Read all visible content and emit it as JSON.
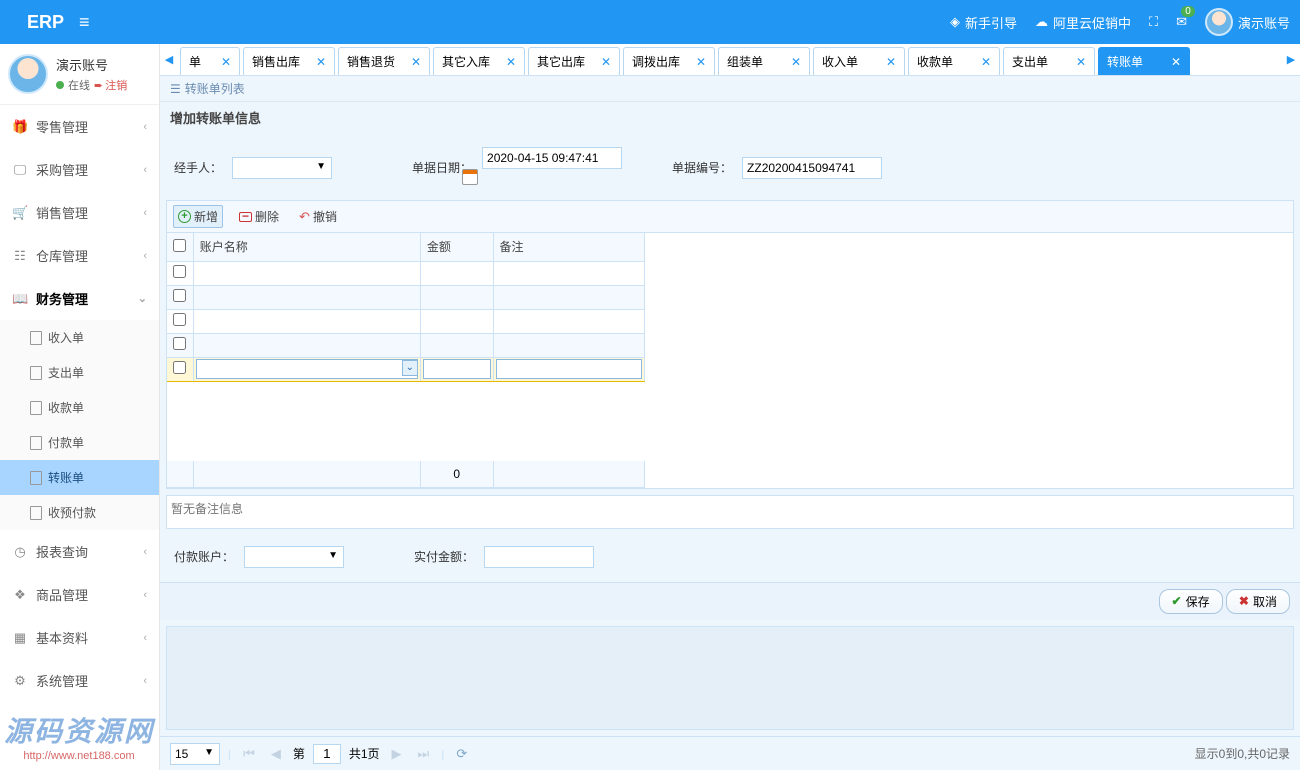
{
  "header": {
    "brand": "ERP",
    "guide": "新手引导",
    "promo": "阿里云促销中",
    "msg_badge": "0",
    "username": "演示账号"
  },
  "user_block": {
    "name": "演示账号",
    "online": "在线",
    "logout": "注销"
  },
  "sidebar": {
    "items": [
      {
        "label": "零售管理"
      },
      {
        "label": "采购管理"
      },
      {
        "label": "销售管理"
      },
      {
        "label": "仓库管理"
      },
      {
        "label": "财务管理"
      },
      {
        "label": "报表查询"
      },
      {
        "label": "商品管理"
      },
      {
        "label": "基本资料"
      },
      {
        "label": "系统管理"
      }
    ],
    "finance_sub": [
      {
        "label": "收入单"
      },
      {
        "label": "支出单"
      },
      {
        "label": "收款单"
      },
      {
        "label": "付款单"
      },
      {
        "label": "转账单"
      },
      {
        "label": "收预付款"
      }
    ]
  },
  "tabs": [
    {
      "label": "单"
    },
    {
      "label": "销售出库"
    },
    {
      "label": "销售退货"
    },
    {
      "label": "其它入库"
    },
    {
      "label": "其它出库"
    },
    {
      "label": "调拨出库"
    },
    {
      "label": "组装单"
    },
    {
      "label": "收入单"
    },
    {
      "label": "收款单"
    },
    {
      "label": "支出单"
    },
    {
      "label": "转账单"
    }
  ],
  "crumbs": "转账单列表",
  "section_title": "增加转账单信息",
  "form": {
    "handler_label": "经手人：",
    "date_label": "单据日期：",
    "date_value": "2020-04-15 09:47:41",
    "code_label": "单据编号：",
    "code_value": "ZZ20200415094741",
    "pay_account_label": "付款账户：",
    "actual_pay_label": "实付金额："
  },
  "toolbar": {
    "add": "新增",
    "delete": "删除",
    "undo": "撤销"
  },
  "grid": {
    "cols": [
      "账户名称",
      "金额",
      "备注"
    ],
    "footer_amount": "0"
  },
  "remarks_placeholder": "暂无备注信息",
  "actions": {
    "save": "保存",
    "cancel": "取消"
  },
  "pager": {
    "page_size": "15",
    "page_label_prefix": "第",
    "page_value": "1",
    "page_total": "共1页",
    "info": "显示0到0,共0记录"
  },
  "watermark": {
    "line1": "源码资源网",
    "line2": "http://www.net188.com"
  }
}
